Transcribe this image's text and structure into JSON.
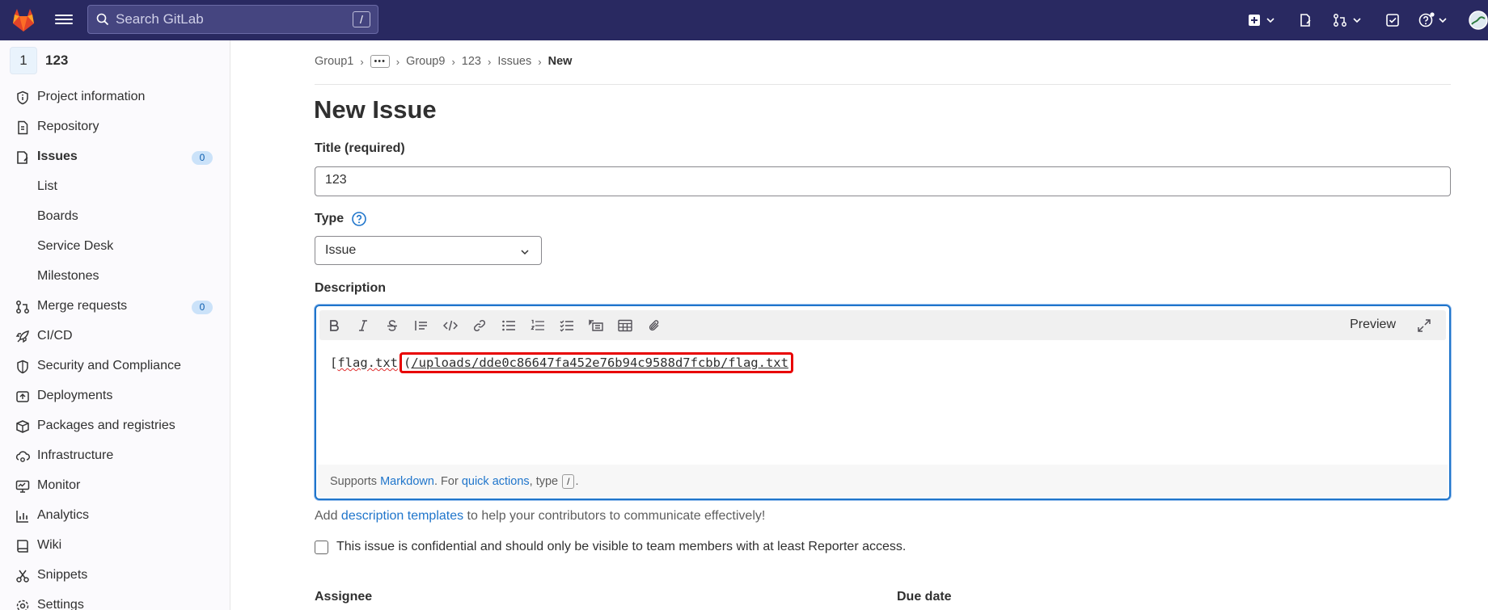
{
  "topbar": {
    "search_placeholder": "Search GitLab",
    "search_shortcut": "/"
  },
  "sidebar": {
    "project_avatar": "1",
    "project_name": "123",
    "items": [
      {
        "label": "Project information",
        "icon": "project-info-icon"
      },
      {
        "label": "Repository",
        "icon": "repository-icon"
      },
      {
        "label": "Issues",
        "icon": "issues-icon",
        "badge": "0",
        "active": true
      },
      {
        "label": "List"
      },
      {
        "label": "Boards"
      },
      {
        "label": "Service Desk"
      },
      {
        "label": "Milestones"
      },
      {
        "label": "Merge requests",
        "icon": "merge-request-icon",
        "badge": "0"
      },
      {
        "label": "CI/CD",
        "icon": "rocket-icon"
      },
      {
        "label": "Security and Compliance",
        "icon": "shield-icon"
      },
      {
        "label": "Deployments",
        "icon": "deployments-icon"
      },
      {
        "label": "Packages and registries",
        "icon": "package-icon"
      },
      {
        "label": "Infrastructure",
        "icon": "cloud-gear-icon"
      },
      {
        "label": "Monitor",
        "icon": "monitor-icon"
      },
      {
        "label": "Analytics",
        "icon": "chart-icon"
      },
      {
        "label": "Wiki",
        "icon": "book-icon"
      },
      {
        "label": "Snippets",
        "icon": "snippet-icon"
      },
      {
        "label": "Settings",
        "icon": "gear-icon"
      }
    ]
  },
  "breadcrumb": {
    "items": [
      "Group1",
      "Group9",
      "123",
      "Issues"
    ],
    "ellipsis": "•••",
    "current": "New"
  },
  "page": {
    "title": "New Issue",
    "title_label": "Title (required)",
    "title_value": "123",
    "type_label": "Type",
    "type_value": "Issue",
    "description_label": "Description"
  },
  "editor": {
    "preview_label": "Preview",
    "text_prefix": "[",
    "text_file": "flag.txt",
    "text_link_open": "(",
    "text_link": "/uploads/dde0c86647fa452e76b94c9588d7fcbb/flag.txt",
    "footer_supports": "Supports ",
    "footer_markdown": "Markdown",
    "footer_for": ". For ",
    "footer_quick_actions": "quick actions",
    "footer_type": ", type ",
    "footer_kbd": "/",
    "footer_end": "."
  },
  "hint": {
    "prefix": "Add ",
    "link": "description templates",
    "suffix": " to help your contributors to communicate effectively!"
  },
  "confidential_label": "This issue is confidential and should only be visible to team members with at least Reporter access.",
  "assignee_label": "Assignee",
  "due_date_label": "Due date",
  "colors": {
    "topbar": "#292961",
    "focus": "#1f75cb",
    "highlight": "#e80000"
  }
}
